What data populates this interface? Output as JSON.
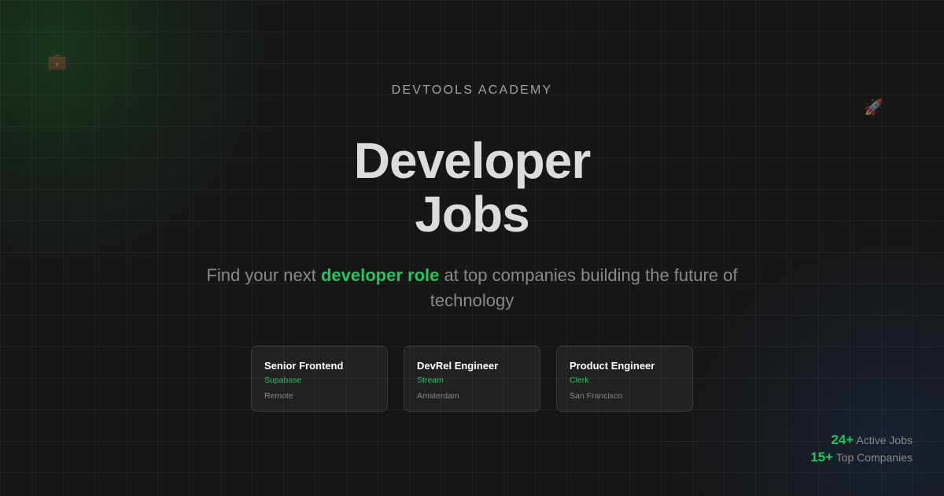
{
  "decorations": {
    "briefcase_icon": "💼",
    "rocket_icon": "🚀"
  },
  "header": {
    "eyebrow": "DEVTOOLS ACADEMY",
    "title_line1": "Developer",
    "title_line2": "Jobs"
  },
  "subtitle": {
    "before": "Find your next ",
    "highlight": "developer role",
    "after": " at top companies building the future of technology"
  },
  "jobs": [
    {
      "role": "Senior Frontend",
      "company": "Supabase",
      "location": "Remote"
    },
    {
      "role": "DevRel Engineer",
      "company": "Stream",
      "location": "Amsterdam"
    },
    {
      "role": "Product Engineer",
      "company": "Clerk",
      "location": "San Francisco"
    }
  ],
  "stats": [
    {
      "value": "24+",
      "label": "Active Jobs"
    },
    {
      "value": "15+",
      "label": "Top Companies"
    }
  ],
  "colors": {
    "accent": "#22c55e",
    "background": "#161616"
  }
}
